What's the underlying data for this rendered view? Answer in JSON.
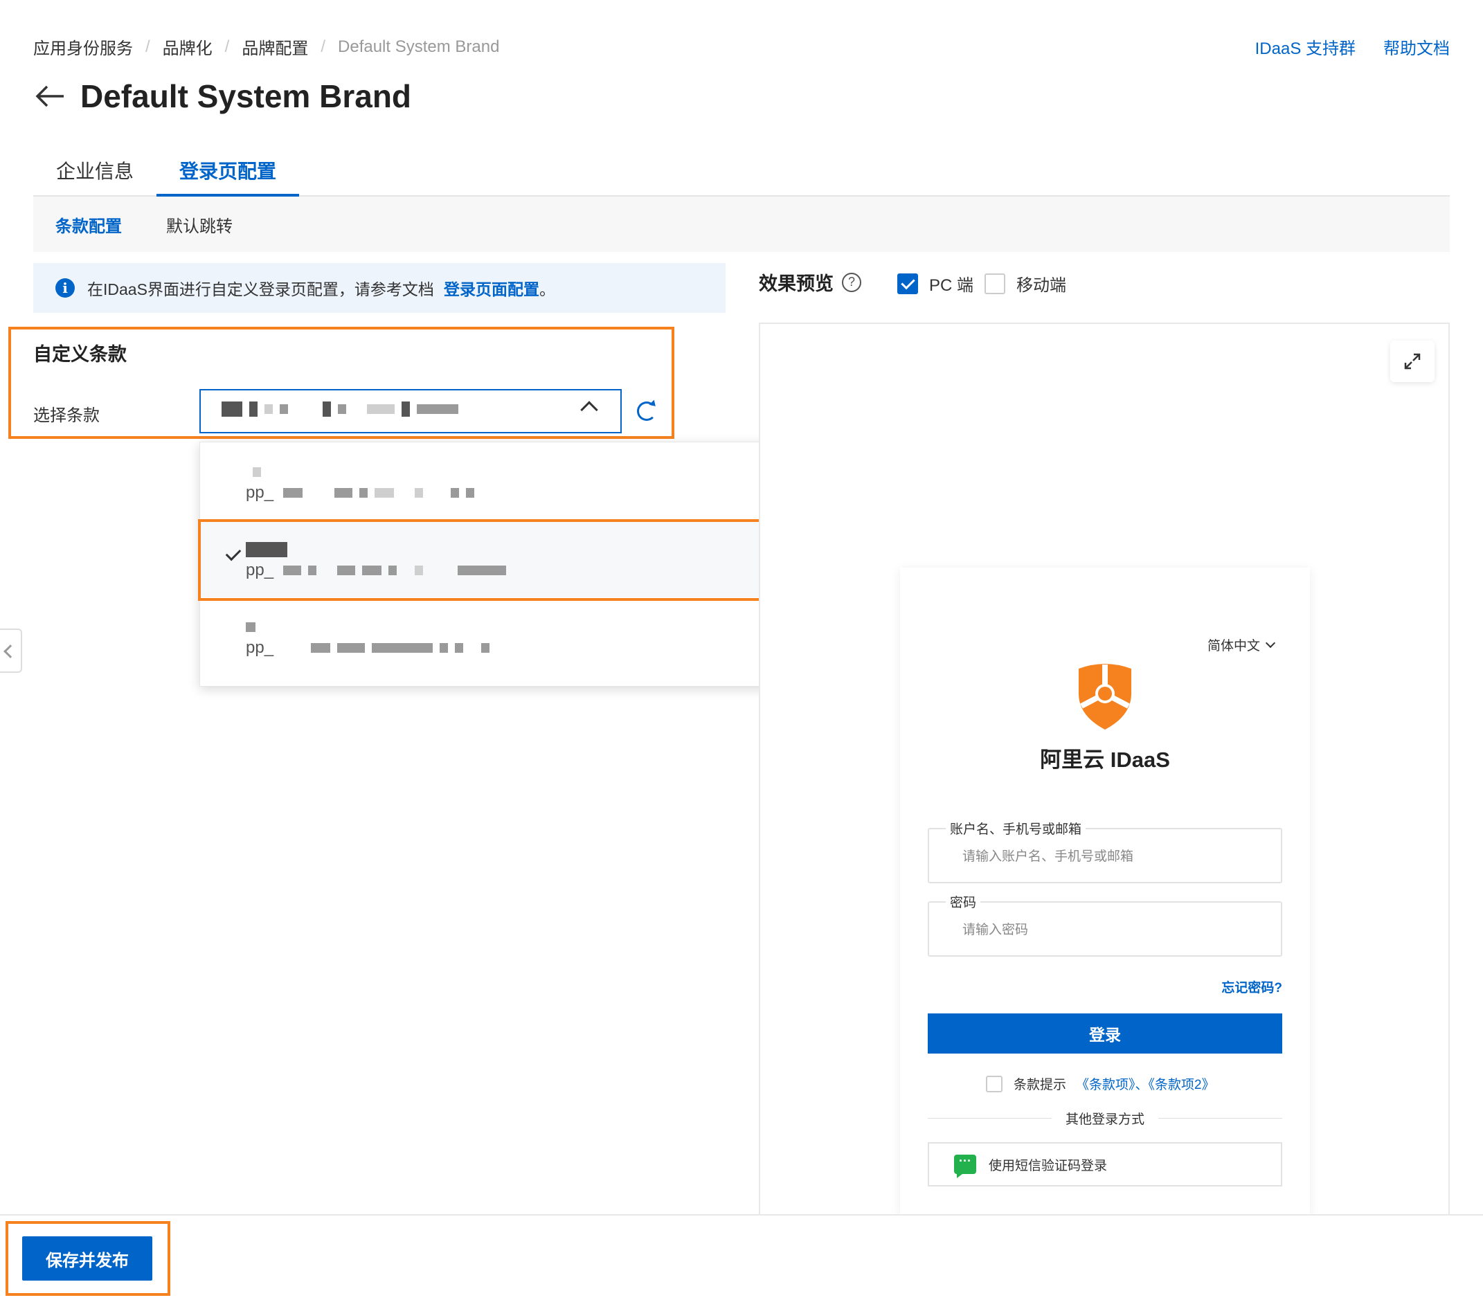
{
  "breadcrumb": [
    "应用身份服务",
    "品牌化",
    "品牌配置",
    "Default System Brand"
  ],
  "top_links": {
    "support": "IDaaS 支持群",
    "help": "帮助文档"
  },
  "page_title": "Default System Brand",
  "tabs": [
    {
      "label": "企业信息",
      "active": false
    },
    {
      "label": "登录页配置",
      "active": true
    }
  ],
  "subtabs": [
    {
      "label": "条款配置",
      "active": true
    },
    {
      "label": "默认跳转",
      "active": false
    }
  ],
  "info": {
    "text": "在IDaaS界面进行自定义登录页配置，请参考文档",
    "link": "登录页面配置",
    "suffix": "。"
  },
  "custom_terms": {
    "title": "自定义条款",
    "select_label": "选择条款",
    "selected_value": "(redacted)",
    "options": [
      {
        "id_prefix": "pp_",
        "selected": false
      },
      {
        "id_prefix": "pp_",
        "selected": true
      },
      {
        "id_prefix": "pp_",
        "selected": false
      }
    ]
  },
  "preview": {
    "title": "效果预览",
    "help_icon": "question-circle-icon",
    "modes": [
      {
        "label": "PC 端",
        "checked": true
      },
      {
        "label": "移动端",
        "checked": false
      }
    ],
    "login_card": {
      "language": "简体中文",
      "brand_name": "阿里云 IDaaS",
      "account_label": "账户名、手机号或邮箱",
      "account_placeholder": "请输入账户名、手机号或邮箱",
      "password_label": "密码",
      "password_placeholder": "请输入密码",
      "forgot": "忘记密码?",
      "login_button": "登录",
      "terms_prefix": "条款提示",
      "terms_links": "《条款项》、《条款项2》",
      "other_methods": "其他登录方式",
      "sms_login": "使用短信验证码登录"
    }
  },
  "footer": {
    "save_button": "保存并发布"
  },
  "colors": {
    "primary": "#0064c8",
    "highlight": "#f5821f",
    "brand_logo": "#f5821f",
    "sms_icon": "#22b14c"
  }
}
